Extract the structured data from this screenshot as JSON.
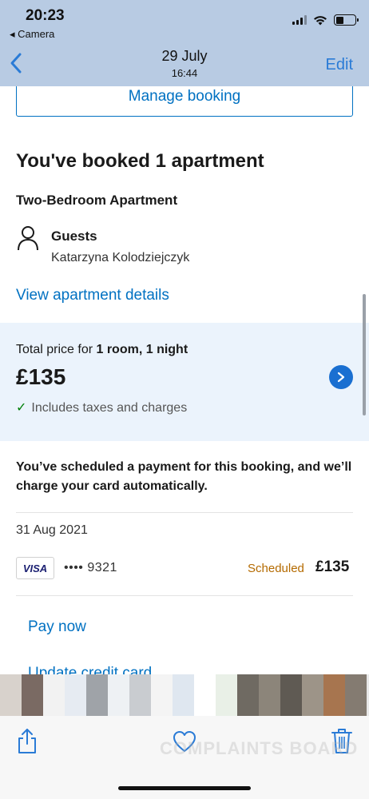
{
  "status_bar": {
    "time": "20:23",
    "back_app": "◂ Camera"
  },
  "nav": {
    "title": "29 July",
    "subtitle": "16:44",
    "edit_label": "Edit"
  },
  "booking": {
    "manage_label": "Manage booking",
    "title": "You've booked 1 apartment",
    "room_name": "Two-Bedroom Apartment",
    "guests_label": "Guests",
    "guest_name": "Katarzyna Kolodziejczyk",
    "view_details_label": "View apartment details"
  },
  "price": {
    "label_prefix": "Total price for ",
    "label_bold": "1 room, 1 night",
    "amount": "£135",
    "includes": "Includes taxes and charges"
  },
  "payment": {
    "message": "You’ve scheduled a payment for this booking, and we’ll charge your card automatically.",
    "date": "31 Aug 2021",
    "card_brand": "VISA",
    "card_number": "•••• 9321",
    "status": "Scheduled",
    "amount": "£135",
    "pay_now_label": "Pay now",
    "update_card_label": "Update credit card"
  },
  "toolbar": {
    "watermark": "COMPLAINTS BOARD"
  },
  "colors": {
    "accent": "#0071c2",
    "header_bg": "#b8cbe3",
    "price_panel_bg": "#ebf3fc",
    "scheduled": "#b46a00"
  },
  "icons": {
    "back": "chevron-left-icon",
    "guest": "person-icon",
    "price_arrow": "chevron-right-icon",
    "share": "share-icon",
    "favorite": "heart-icon",
    "delete": "trash-icon"
  }
}
